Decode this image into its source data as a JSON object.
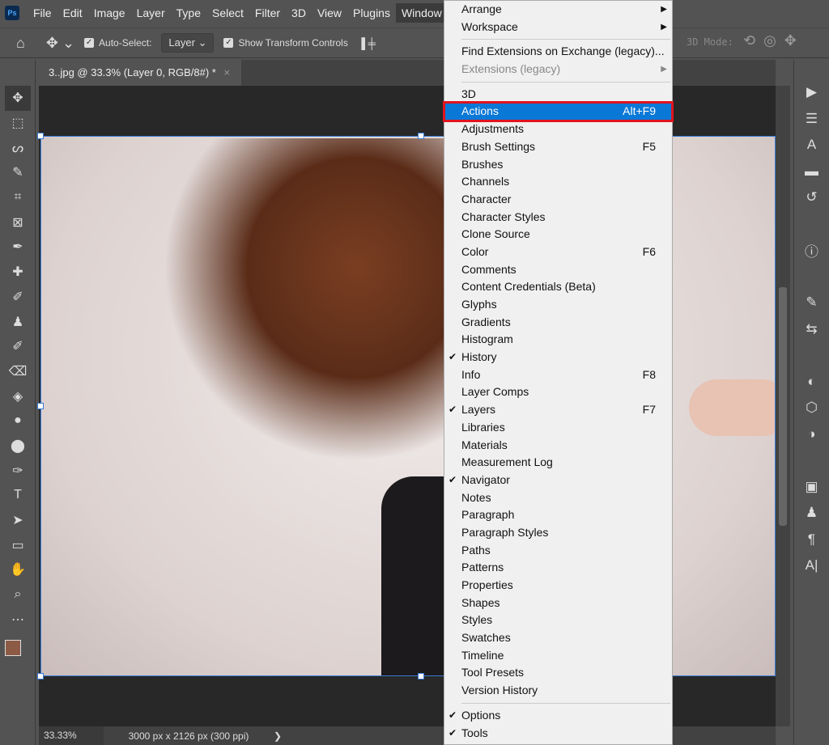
{
  "menubar": {
    "logo": "Ps",
    "items": [
      "File",
      "Edit",
      "Image",
      "Layer",
      "Type",
      "Select",
      "Filter",
      "3D",
      "View",
      "Plugins",
      "Window"
    ]
  },
  "options": {
    "auto_select": "Auto-Select:",
    "layer": "Layer",
    "show_transform": "Show Transform Controls",
    "mode": "3D Mode:"
  },
  "document": {
    "tab": "3..jpg @ 33.3% (Layer 0, RGB/8#) *",
    "close": "×"
  },
  "status": {
    "zoom": "33.33%",
    "size": "3000 px x 2126 px (300 ppi)",
    "arrow": "❯"
  },
  "colors": {
    "foreground": "#8c5a45",
    "highlight": "#0a78d7",
    "outline": "#e0141e"
  },
  "menu": {
    "top": [
      {
        "label": "Arrange",
        "submenu": true
      },
      {
        "label": "Workspace",
        "submenu": true
      }
    ],
    "ext": [
      {
        "label": "Find Extensions on Exchange (legacy)..."
      },
      {
        "label": "Extensions (legacy)",
        "submenu": true,
        "disabled": true
      }
    ],
    "panels": [
      {
        "label": "3D"
      },
      {
        "label": "Actions",
        "shortcut": "Alt+F9",
        "highlighted": true
      },
      {
        "label": "Adjustments"
      },
      {
        "label": "Brush Settings",
        "shortcut": "F5"
      },
      {
        "label": "Brushes"
      },
      {
        "label": "Channels"
      },
      {
        "label": "Character"
      },
      {
        "label": "Character Styles"
      },
      {
        "label": "Clone Source"
      },
      {
        "label": "Color",
        "shortcut": "F6"
      },
      {
        "label": "Comments"
      },
      {
        "label": "Content Credentials (Beta)"
      },
      {
        "label": "Glyphs"
      },
      {
        "label": "Gradients"
      },
      {
        "label": "Histogram"
      },
      {
        "label": "History",
        "checked": true
      },
      {
        "label": "Info",
        "shortcut": "F8"
      },
      {
        "label": "Layer Comps"
      },
      {
        "label": "Layers",
        "shortcut": "F7",
        "checked": true
      },
      {
        "label": "Libraries"
      },
      {
        "label": "Materials"
      },
      {
        "label": "Measurement Log"
      },
      {
        "label": "Navigator",
        "checked": true
      },
      {
        "label": "Notes"
      },
      {
        "label": "Paragraph"
      },
      {
        "label": "Paragraph Styles"
      },
      {
        "label": "Paths"
      },
      {
        "label": "Patterns"
      },
      {
        "label": "Properties"
      },
      {
        "label": "Shapes"
      },
      {
        "label": "Styles"
      },
      {
        "label": "Swatches"
      },
      {
        "label": "Timeline"
      },
      {
        "label": "Tool Presets"
      },
      {
        "label": "Version History"
      }
    ],
    "bottom": [
      {
        "label": "Options",
        "checked": true
      },
      {
        "label": "Tools",
        "checked": true
      }
    ]
  }
}
